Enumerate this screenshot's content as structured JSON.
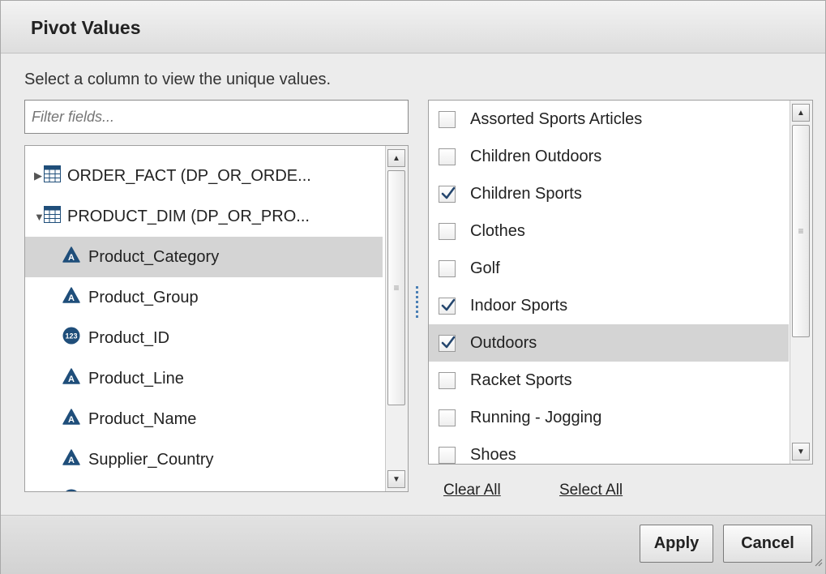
{
  "dialog": {
    "title": "Pivot Values",
    "instruction": "Select a column to view the unique values."
  },
  "filter": {
    "placeholder": "Filter fields..."
  },
  "tree": {
    "tables": [
      {
        "label": "ORDER_FACT (DP_OR_ORDE...",
        "expanded": false
      },
      {
        "label": "PRODUCT_DIM (DP_OR_PRO...",
        "expanded": true
      }
    ],
    "fields": [
      {
        "label": "Product_Category",
        "type": "character",
        "selected": true
      },
      {
        "label": "Product_Group",
        "type": "character",
        "selected": false
      },
      {
        "label": "Product_ID",
        "type": "numeric",
        "icon_text": "123",
        "selected": false
      },
      {
        "label": "Product_Line",
        "type": "character",
        "selected": false
      },
      {
        "label": "Product_Name",
        "type": "character",
        "selected": false
      },
      {
        "label": "Supplier_Country",
        "type": "character",
        "selected": false
      }
    ]
  },
  "values": {
    "items": [
      {
        "label": "Assorted Sports Articles",
        "checked": false,
        "selected": false
      },
      {
        "label": "Children Outdoors",
        "checked": false,
        "selected": false
      },
      {
        "label": "Children Sports",
        "checked": true,
        "selected": false
      },
      {
        "label": "Clothes",
        "checked": false,
        "selected": false
      },
      {
        "label": "Golf",
        "checked": false,
        "selected": false
      },
      {
        "label": "Indoor Sports",
        "checked": true,
        "selected": false
      },
      {
        "label": "Outdoors",
        "checked": true,
        "selected": true
      },
      {
        "label": "Racket Sports",
        "checked": false,
        "selected": false
      },
      {
        "label": "Running - Jogging",
        "checked": false,
        "selected": false
      },
      {
        "label": "Shoes",
        "checked": false,
        "selected": false
      }
    ],
    "clear_all": "Clear All",
    "select_all": "Select All"
  },
  "buttons": {
    "apply": "Apply",
    "cancel": "Cancel"
  },
  "colors": {
    "accent": "#1f4e7a",
    "check": "#24466e",
    "selection": "#d4d4d4"
  }
}
